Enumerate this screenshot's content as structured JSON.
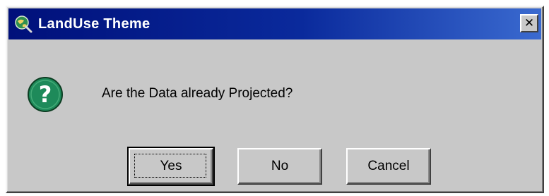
{
  "window": {
    "title": "LandUse Theme",
    "close_glyph": "✕",
    "app_icon": "arcview-globe-icon"
  },
  "dialog": {
    "icon": "question-icon",
    "icon_glyph": "?",
    "message": "Are the Data already Projected?"
  },
  "buttons": {
    "yes": "Yes",
    "no": "No",
    "cancel": "Cancel"
  },
  "colors": {
    "title_bar_start": "#00107a",
    "title_bar_end": "#3a6ad0",
    "dialog_face": "#c8c8c8",
    "question_icon_fill": "#1e8a5a"
  }
}
